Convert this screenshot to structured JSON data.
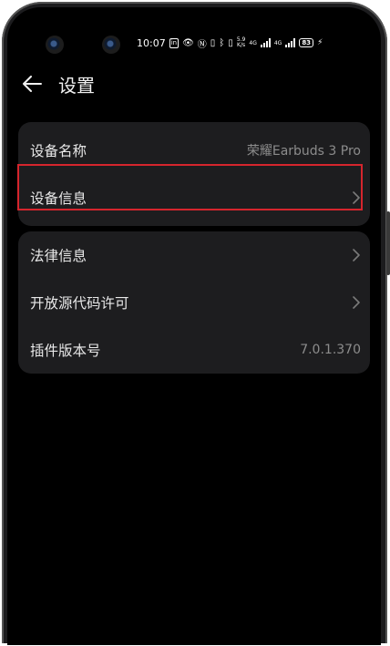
{
  "status_bar": {
    "time": "10:07",
    "network_speed_top": "5.9",
    "network_speed_bottom": "K/s",
    "signal_label_1": "4G",
    "signal_label_2": "4G",
    "battery": "83"
  },
  "header": {
    "title": "设置",
    "back_icon": "arrow-left-icon"
  },
  "settings_group_1": [
    {
      "label": "设备名称",
      "value": "荣耀Earbuds 3 Pro"
    },
    {
      "label": "设备信息",
      "value": ""
    }
  ],
  "settings_group_2": [
    {
      "label": "法律信息",
      "value": ""
    },
    {
      "label": "开放源代码许可",
      "value": ""
    },
    {
      "label": "插件版本号",
      "value": "7.0.1.370"
    }
  ],
  "colors": {
    "background": "#000000",
    "card": "#1d1d1f",
    "highlight": "#d6252d",
    "secondary_text": "#8c8c8c"
  }
}
